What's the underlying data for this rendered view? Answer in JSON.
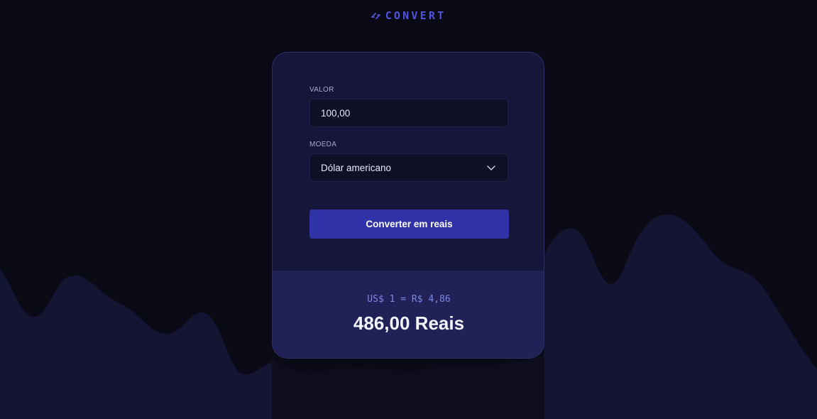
{
  "app": {
    "logo_text": "CONVERT",
    "logo_icon": "arrows-swap-icon"
  },
  "form": {
    "amount_label": "VALOR",
    "amount_value": "100,00",
    "currency_label": "MOEDA",
    "currency_selected": "Dólar americano",
    "currency_icon": "chevron-down-icon",
    "submit_label": "Converter em reais"
  },
  "result": {
    "rate_text": "US$ 1 = R$ 4,86",
    "total_text": "486,00 Reais"
  },
  "colors": {
    "background": "#0a0a16",
    "card": "#15163a",
    "result_panel": "#202257",
    "accent": "#3033a8",
    "logo": "#4f53d8",
    "rate_text": "#7f83e6"
  }
}
